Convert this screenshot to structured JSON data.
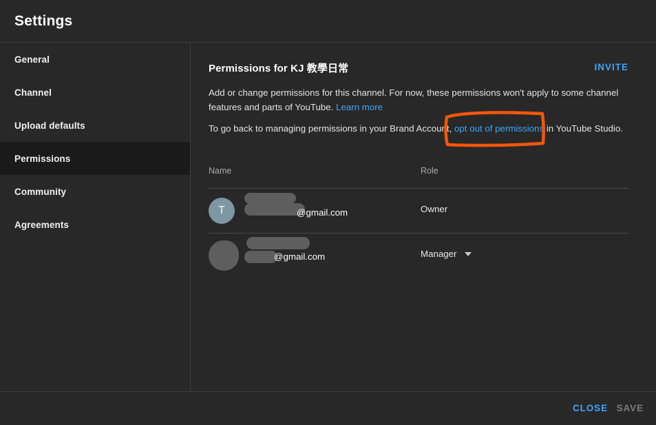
{
  "dialog": {
    "title": "Settings"
  },
  "sidebar": {
    "items": [
      {
        "label": "General",
        "selected": false
      },
      {
        "label": "Channel",
        "selected": false
      },
      {
        "label": "Upload defaults",
        "selected": false
      },
      {
        "label": "Permissions",
        "selected": true
      },
      {
        "label": "Community",
        "selected": false
      },
      {
        "label": "Agreements",
        "selected": false
      }
    ]
  },
  "main": {
    "heading": "Permissions for KJ 教學日常",
    "invite_label": "INVITE",
    "description_part1": "Add or change permissions for this channel. For now, these permissions won't apply to some channel features and parts of YouTube.",
    "learn_more_label": "Learn more",
    "optout_prefix": "To go back to managing permissions in your Brand Account,",
    "optout_link_label": "opt out of permissions",
    "optout_suffix": "in YouTube Studio.",
    "table": {
      "columns": {
        "name": "Name",
        "role": "Role"
      },
      "rows": [
        {
          "avatar_initial": "T",
          "avatar_color": "#7d97a3",
          "email_visible": "@gmail.com",
          "role": "Owner",
          "role_editable": false
        },
        {
          "avatar_initial": "",
          "avatar_color": "#5e5e5e",
          "email_visible": "@gmail.com",
          "role": "Manager",
          "role_editable": true
        }
      ]
    }
  },
  "footer": {
    "close_label": "CLOSE",
    "save_label": "SAVE"
  },
  "annotation": {
    "color": "#f4560b",
    "shape": "hand-drawn-rectangle",
    "target": "opt out of permissions"
  },
  "colors": {
    "background": "#282828",
    "accent_link": "#3ea6ff",
    "selected_nav": "#1a1a1a",
    "divider": "#3d3d3d",
    "annotation": "#f4560b"
  }
}
